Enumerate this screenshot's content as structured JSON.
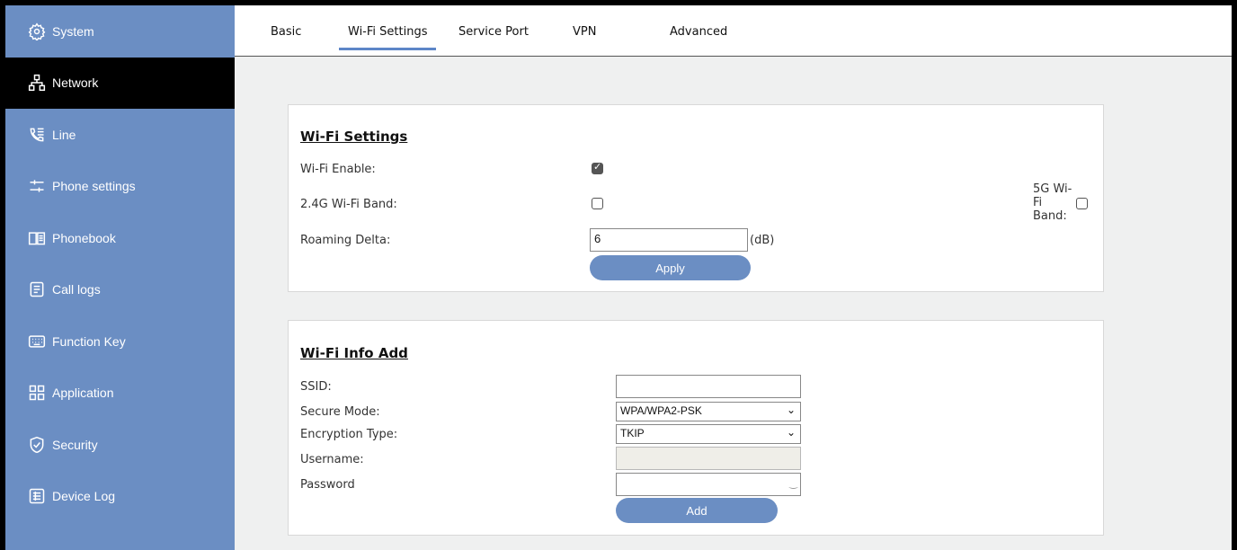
{
  "sidebar": {
    "items": [
      {
        "label": "System",
        "icon": "gear-icon"
      },
      {
        "label": "Network",
        "icon": "network-icon"
      },
      {
        "label": "Line",
        "icon": "phone-list-icon"
      },
      {
        "label": "Phone settings",
        "icon": "sliders-icon"
      },
      {
        "label": "Phonebook",
        "icon": "book-icon"
      },
      {
        "label": "Call logs",
        "icon": "document-icon"
      },
      {
        "label": "Function Key",
        "icon": "keyboard-icon"
      },
      {
        "label": "Application",
        "icon": "grid-icon"
      },
      {
        "label": "Security",
        "icon": "shield-icon"
      },
      {
        "label": "Device Log",
        "icon": "log-icon"
      }
    ],
    "active_index": 1,
    "bg_color": "#6b8ec3",
    "active_color": "#000000"
  },
  "tabs": [
    {
      "label": "Basic"
    },
    {
      "label": "Wi-Fi Settings"
    },
    {
      "label": "Service Port"
    },
    {
      "label": "VPN"
    },
    {
      "label": "Advanced"
    }
  ],
  "active_tab": "Wi-Fi Settings",
  "wifi_settings": {
    "title": "Wi-Fi Settings",
    "enable_label": "Wi-Fi Enable:",
    "enable_checked": true,
    "band24_label": "2.4G Wi-Fi Band:",
    "band24_checked": false,
    "band5_label": "5G Wi-Fi Band:",
    "band5_checked": false,
    "roaming_label": "Roaming Delta:",
    "roaming_value": "6",
    "roaming_unit": "(dB)",
    "apply_label": "Apply"
  },
  "wifi_info": {
    "title": "Wi-Fi Info Add",
    "ssid_label": "SSID:",
    "ssid_value": "",
    "secure_mode_label": "Secure Mode:",
    "secure_mode_value": "WPA/WPA2-PSK",
    "encryption_label": "Encryption Type:",
    "encryption_value": "TKIP",
    "username_label": "Username:",
    "username_value": "",
    "password_label": "Password",
    "password_value": "",
    "add_label": "Add"
  },
  "colors": {
    "accent": "#6b8ec3",
    "tab_underline": "#5d86c8"
  }
}
